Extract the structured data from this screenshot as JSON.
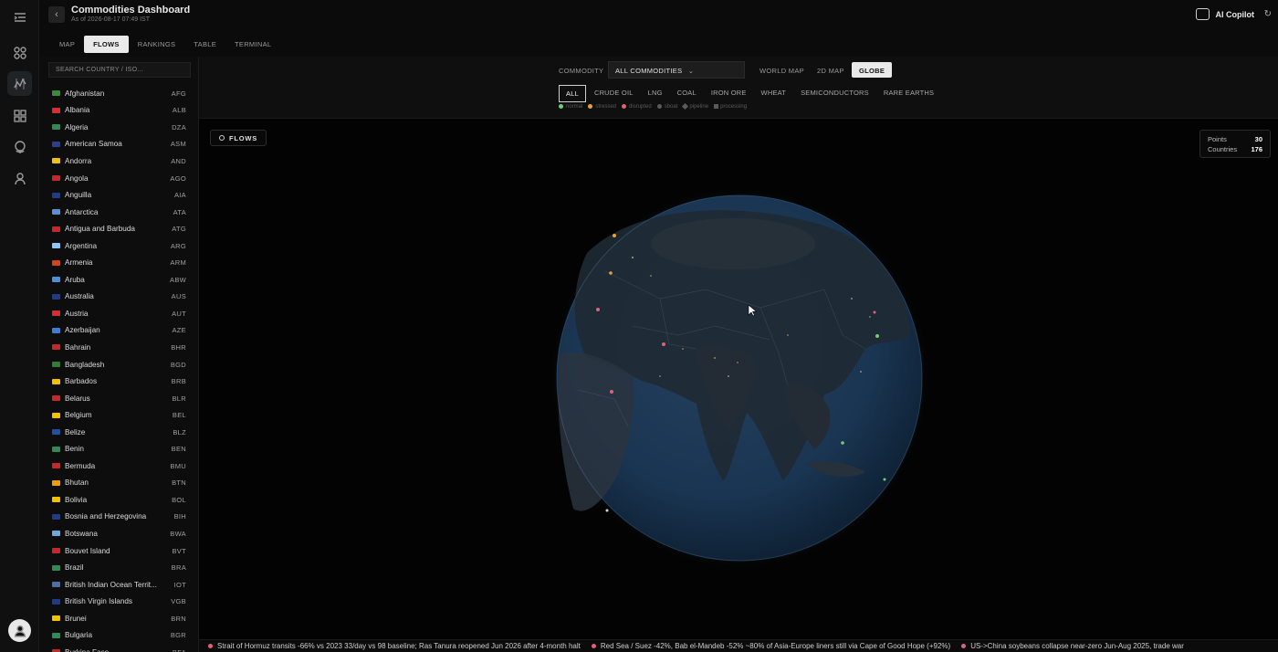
{
  "header": {
    "title": "Commodities Dashboard",
    "subtitle": "As of 2026-08-17 07:49 IST",
    "copilot_label": "AI Copilot"
  },
  "tabs": [
    {
      "label": "MAP",
      "active": false
    },
    {
      "label": "FLOWS",
      "active": true
    },
    {
      "label": "RANKINGS",
      "active": false
    },
    {
      "label": "TABLE",
      "active": false
    },
    {
      "label": "TERMINAL",
      "active": false
    }
  ],
  "sidebar": {
    "search_placeholder": "SEARCH COUNTRY / ISO...",
    "countries": [
      {
        "name": "Afghanistan",
        "iso": "AFG",
        "flag": "#3a8a3a"
      },
      {
        "name": "Albania",
        "iso": "ALB",
        "flag": "#d32f2f"
      },
      {
        "name": "Algeria",
        "iso": "DZA",
        "flag": "#2e8b57"
      },
      {
        "name": "American Samoa",
        "iso": "ASM",
        "flag": "#2c3e8c"
      },
      {
        "name": "Andorra",
        "iso": "AND",
        "flag": "#f2c200"
      },
      {
        "name": "Angola",
        "iso": "AGO",
        "flag": "#c62828"
      },
      {
        "name": "Anguilla",
        "iso": "AIA",
        "flag": "#1f3b8a"
      },
      {
        "name": "Antarctica",
        "iso": "ATA",
        "flag": "#5b8fd6"
      },
      {
        "name": "Antigua and Barbuda",
        "iso": "ATG",
        "flag": "#c62828"
      },
      {
        "name": "Argentina",
        "iso": "ARG",
        "flag": "#8ec5ff"
      },
      {
        "name": "Armenia",
        "iso": "ARM",
        "flag": "#d84315"
      },
      {
        "name": "Aruba",
        "iso": "ABW",
        "flag": "#4a90d9"
      },
      {
        "name": "Australia",
        "iso": "AUS",
        "flag": "#1f3b8a"
      },
      {
        "name": "Austria",
        "iso": "AUT",
        "flag": "#d32f2f"
      },
      {
        "name": "Azerbaijan",
        "iso": "AZE",
        "flag": "#3b7dd8"
      },
      {
        "name": "Bahrain",
        "iso": "BHR",
        "flag": "#c62828"
      },
      {
        "name": "Bangladesh",
        "iso": "BGD",
        "flag": "#2e7d32"
      },
      {
        "name": "Barbados",
        "iso": "BRB",
        "flag": "#f2c200"
      },
      {
        "name": "Belarus",
        "iso": "BLR",
        "flag": "#c62828"
      },
      {
        "name": "Belgium",
        "iso": "BEL",
        "flag": "#f2c200"
      },
      {
        "name": "Belize",
        "iso": "BLZ",
        "flag": "#1f4fa8"
      },
      {
        "name": "Benin",
        "iso": "BEN",
        "flag": "#2e8b57"
      },
      {
        "name": "Bermuda",
        "iso": "BMU",
        "flag": "#c62828"
      },
      {
        "name": "Bhutan",
        "iso": "BTN",
        "flag": "#f29c00"
      },
      {
        "name": "Bolivia",
        "iso": "BOL",
        "flag": "#f2c200"
      },
      {
        "name": "Bosnia and Herzegovina",
        "iso": "BIH",
        "flag": "#1f3b8a"
      },
      {
        "name": "Botswana",
        "iso": "BWA",
        "flag": "#6fa8dc"
      },
      {
        "name": "Bouvet Island",
        "iso": "BVT",
        "flag": "#c62828"
      },
      {
        "name": "Brazil",
        "iso": "BRA",
        "flag": "#2e8b57"
      },
      {
        "name": "British Indian Ocean Territ...",
        "iso": "IOT",
        "flag": "#4a6fa8"
      },
      {
        "name": "British Virgin Islands",
        "iso": "VGB",
        "flag": "#1f3b8a"
      },
      {
        "name": "Brunei",
        "iso": "BRN",
        "flag": "#f2c200"
      },
      {
        "name": "Bulgaria",
        "iso": "BGR",
        "flag": "#2e8b57"
      },
      {
        "name": "Burkina Faso",
        "iso": "BFA",
        "flag": "#c62828"
      }
    ]
  },
  "controls": {
    "commodity_label": "COMMODITY",
    "commodity_value": "ALL COMMODITIES",
    "views": [
      {
        "label": "WORLD MAP",
        "active": false
      },
      {
        "label": "2D MAP",
        "active": false
      },
      {
        "label": "GLOBE",
        "active": true
      }
    ],
    "filters": [
      {
        "label": "ALL",
        "active": true
      },
      {
        "label": "CRUDE OIL",
        "active": false
      },
      {
        "label": "LNG",
        "active": false
      },
      {
        "label": "COAL",
        "active": false
      },
      {
        "label": "IRON ORE",
        "active": false
      },
      {
        "label": "WHEAT",
        "active": false
      },
      {
        "label": "SEMICONDUCTORS",
        "active": false
      },
      {
        "label": "RARE EARTHS",
        "active": false
      }
    ],
    "legend": {
      "normal": "normal",
      "stressed": "stressed",
      "disrupted": "disrupted",
      "sboat": "sboat",
      "pipeline": "pipeline",
      "processing": "processing",
      "normal_color": "#6fcf6f",
      "stressed_color": "#e8a13a",
      "disrupted_color": "#e0607a"
    }
  },
  "flows_chip": "FLOWS",
  "stats": {
    "points_label": "Points",
    "points_value": "30",
    "countries_label": "Countries",
    "countries_value": "176"
  },
  "ticker": [
    "Strait of Hormuz transits -66% vs 2023  33/day vs 98 baseline; Ras Tanura reopened Jun 2026 after 4-month halt",
    "Red Sea / Suez -42%, Bab el-Mandeb -52%  ~80% of Asia-Europe liners still via Cape of Good Hope (+92%)",
    "US->China soybeans collapse  near-zero Jun-Aug 2025, trade war"
  ]
}
